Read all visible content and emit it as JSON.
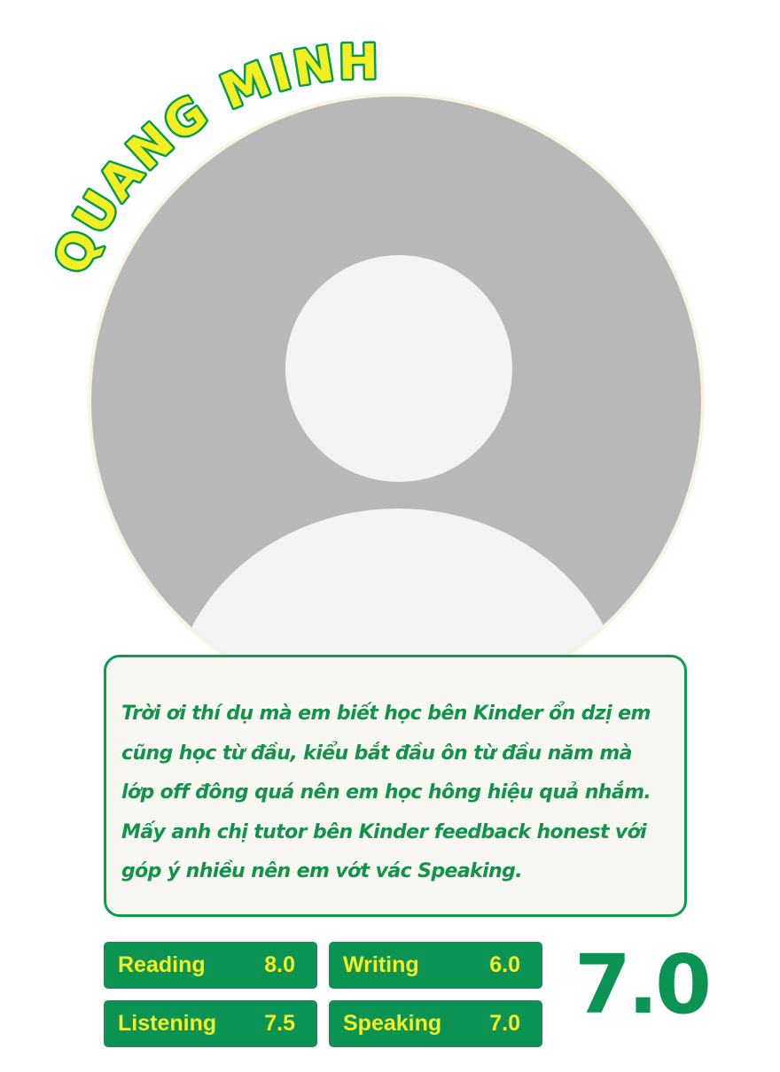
{
  "student": {
    "name": "QUANG MINH"
  },
  "avatar": {
    "icon": "default-user-avatar-icon"
  },
  "testimonial": {
    "text": "Trời ơi thí dụ mà em biết học bên Kinder ổn dzị em\ncũng học từ đầu, kiểu bắt đầu ôn từ đầu năm mà\nlớp off đông quá nên em học hông hiệu quả nhắm.\nMấy anh chị tutor bên Kinder feedback honest với\ngóp ý nhiều nên em vớt vác Speaking."
  },
  "scores": {
    "reading": {
      "label": "Reading",
      "value": "8.0"
    },
    "writing": {
      "label": "Writing",
      "value": "6.0"
    },
    "listening": {
      "label": "Listening",
      "value": "7.5"
    },
    "speaking": {
      "label": "Speaking",
      "value": "7.0"
    },
    "overall": "7.0"
  },
  "colors": {
    "brand_green": "#0b9353",
    "accent_yellow": "#f4ee24",
    "avatar_gray": "#b8b8b8",
    "avatar_silhouette": "#f3f3f3",
    "card_background": "#f8f7f1"
  }
}
